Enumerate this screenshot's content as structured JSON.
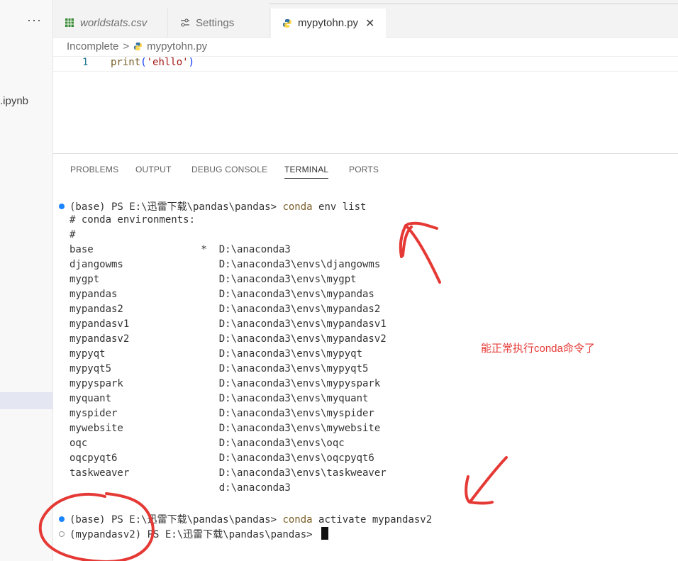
{
  "sidebar": {
    "more": "···",
    "partial_file": ".ipynb"
  },
  "tabs": [
    {
      "label": "worldstats.csv",
      "icon": "table-icon"
    },
    {
      "label": "Settings",
      "icon": "settings-sliders-icon"
    },
    {
      "label": "mypytohn.py",
      "icon": "python-icon",
      "active": true,
      "close": "✕"
    }
  ],
  "breadcrumb": {
    "folder": "Incomplete",
    "sep": ">",
    "file": "mypytohn.py"
  },
  "editor": {
    "line_number": "1",
    "code_fn": "print",
    "code_open": "(",
    "code_str": "'ehllo'",
    "code_close": ")"
  },
  "panel_tabs": [
    "PROBLEMS",
    "OUTPUT",
    "DEBUG CONSOLE",
    "TERMINAL",
    "PORTS"
  ],
  "terminal": {
    "prompt1": "(base) PS E:\\迅雷下载\\pandas\\pandas> ",
    "cmd1_a": "conda",
    "cmd1_b": " env list",
    "header1": "# conda environments:",
    "header2": "#",
    "envs": [
      "base                  *  D:\\anaconda3",
      "djangowms                D:\\anaconda3\\envs\\djangowms",
      "mygpt                    D:\\anaconda3\\envs\\mygpt",
      "mypandas                 D:\\anaconda3\\envs\\mypandas",
      "mypandas2                D:\\anaconda3\\envs\\mypandas2",
      "mypandasv1               D:\\anaconda3\\envs\\mypandasv1",
      "mypandasv2               D:\\anaconda3\\envs\\mypandasv2",
      "mypyqt                   D:\\anaconda3\\envs\\mypyqt",
      "mypyqt5                  D:\\anaconda3\\envs\\mypyqt5",
      "mypyspark                D:\\anaconda3\\envs\\mypyspark",
      "myquant                  D:\\anaconda3\\envs\\myquant",
      "myspider                 D:\\anaconda3\\envs\\myspider",
      "mywebsite                D:\\anaconda3\\envs\\mywebsite",
      "oqc                      D:\\anaconda3\\envs\\oqc",
      "oqcpyqt6                 D:\\anaconda3\\envs\\oqcpyqt6",
      "taskweaver               D:\\anaconda3\\envs\\taskweaver",
      "                         d:\\anaconda3"
    ],
    "prompt2": "(base) PS E:\\迅雷下载\\pandas\\pandas> ",
    "cmd2_a": "conda",
    "cmd2_b": " activate mypandasv2",
    "prompt3": "(mypandasv2) PS E:\\迅雷下载\\pandas\\pandas> "
  },
  "annotation": "能正常执行conda命令了",
  "colors": {
    "annotation": "#e53935",
    "accent": "#1a85ff"
  }
}
